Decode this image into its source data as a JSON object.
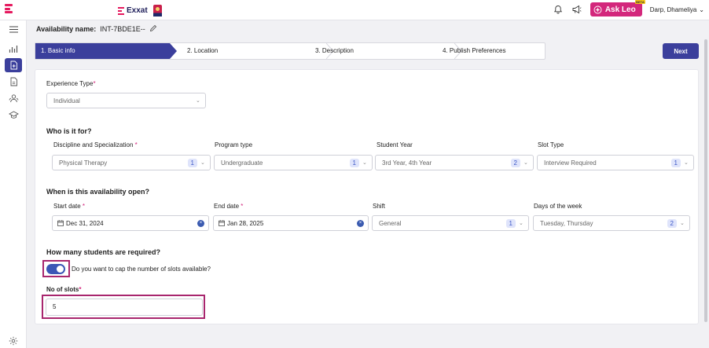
{
  "header": {
    "brand": "Exxat",
    "ask_leo": "Ask Leo",
    "beta": "BETA",
    "user": "Darp, Dhameliya"
  },
  "availability": {
    "label": "Availability name:",
    "value": "INT-7BDE1E--"
  },
  "steps": [
    "1. Basic info",
    "2. Location",
    "3. Description",
    "4. Publish Preferences"
  ],
  "next_label": "Next",
  "form": {
    "experience_type": {
      "label": "Experience Type",
      "value": "Individual"
    },
    "who_title": "Who is it for?",
    "discipline": {
      "label": "Discipline and Specialization ",
      "value": "Physical Therapy",
      "count": "1"
    },
    "program_type": {
      "label": "Program type",
      "value": "Undergraduate",
      "count": "1"
    },
    "student_year": {
      "label": "Student Year",
      "value": "3rd Year, 4th Year",
      "count": "2"
    },
    "slot_type": {
      "label": "Slot Type",
      "value": "Interview Required",
      "count": "1"
    },
    "when_title": "When is this availability open?",
    "start_date": {
      "label": "Start date ",
      "value": "Dec 31, 2024"
    },
    "end_date": {
      "label": "End date ",
      "value": "Jan 28, 2025"
    },
    "shift": {
      "label": "Shift",
      "value": "General",
      "count": "1"
    },
    "days": {
      "label": "Days of the week",
      "value": "Tuesday, Thursday",
      "count": "2"
    },
    "students_title": "How many students are required?",
    "cap_toggle_label": "Do you want to cap the number of slots available?",
    "cap_enabled": true,
    "slots": {
      "label": "No of slots",
      "value": "5"
    }
  },
  "required_mark": "*",
  "colors": {
    "primary": "#3b3f9c",
    "accent": "#d3277c",
    "highlight": "#a8266e"
  }
}
